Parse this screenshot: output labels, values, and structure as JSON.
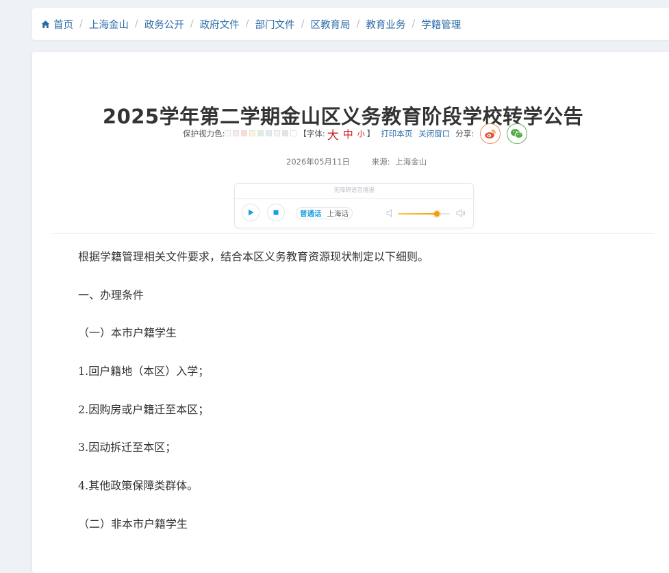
{
  "breadcrumb": {
    "items": [
      "首页",
      "上海金山",
      "政务公开",
      "政府文件",
      "部门文件",
      "区教育局",
      "教育业务",
      "学籍管理"
    ],
    "separator": "/"
  },
  "article": {
    "title": "2025学年第二学期金山区义务教育阶段学校转学公告",
    "toolbar": {
      "eye_care_label": "保护视力色:",
      "swatch_colors": [
        "#fafafa",
        "#fbe9e3",
        "#fdd9d9",
        "#f7f5d8",
        "#dcefde",
        "#d9ecf7",
        "#f3f3f3",
        "#e4e4e4",
        "#ffffff"
      ],
      "font_label": "【字体:",
      "font_large": "大",
      "font_medium": "中",
      "font_small": "小",
      "font_close": "】",
      "print_label": "打印本页",
      "close_label": "关闭窗口",
      "share_label": "分享:"
    },
    "meta": {
      "date": "2026年05月11日",
      "source_label": "来源:",
      "source": "上海金山"
    },
    "audio_player": {
      "title": "无障碍语音播报",
      "language_active": "普通话",
      "language_option": "上海话",
      "volume": 0.75
    },
    "paragraphs": [
      "根据学籍管理相关文件要求，结合本区义务教育资源现状制定以下细则。",
      "一、办理条件",
      "（一）本市户籍学生",
      "1.回户籍地（本区）入学；",
      "2.因购房或户籍迁至本区；",
      "3.因动拆迁至本区；",
      "4.其他政策保障类群体。",
      "（二）非本市户籍学生"
    ]
  },
  "colors": {
    "link": "#2b6aa8",
    "title": "#333333",
    "font_size_red": "#cc1f1f",
    "player_accent": "#1a9fe0",
    "volume_orange": "#f39c12"
  }
}
